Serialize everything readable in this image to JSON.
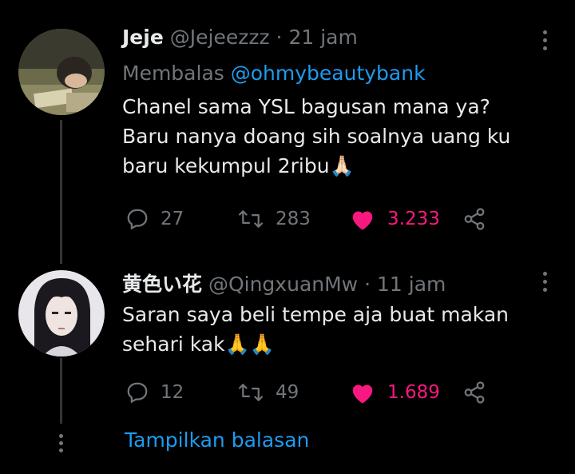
{
  "tweets": [
    {
      "name": "Jeje",
      "handle": "@Jejeezzz",
      "time": "21 jam",
      "reply_prefix": "Membalas",
      "reply_mention": "@ohmybeautybank",
      "lines": [
        "Chanel sama YSL bagusan mana ya?",
        "Baru nanya doang sih soalnya uang ku",
        "baru kekumpul 2ribu🙏🏻"
      ],
      "replies": "27",
      "retweets": "283",
      "likes": "3.233"
    },
    {
      "name": "黄色い花",
      "handle": "@QingxuanMw",
      "time": "11 jam",
      "lines": [
        "Saran saya beli tempe aja buat makan",
        "sehari kak🙏🙏"
      ],
      "replies": "12",
      "retweets": "49",
      "likes": "1.689"
    }
  ],
  "dot_separator": "·",
  "show_replies_label": "Tampilkan balasan",
  "icons": {
    "reply": "reply-icon",
    "retweet": "retweet-icon",
    "like": "heart-icon",
    "share": "share-icon",
    "more": "more-vertical-icon"
  },
  "colors": {
    "background": "#000000",
    "text": "#e7e9ea",
    "muted": "#71767b",
    "link": "#1d9bf0",
    "like": "#f91880"
  }
}
